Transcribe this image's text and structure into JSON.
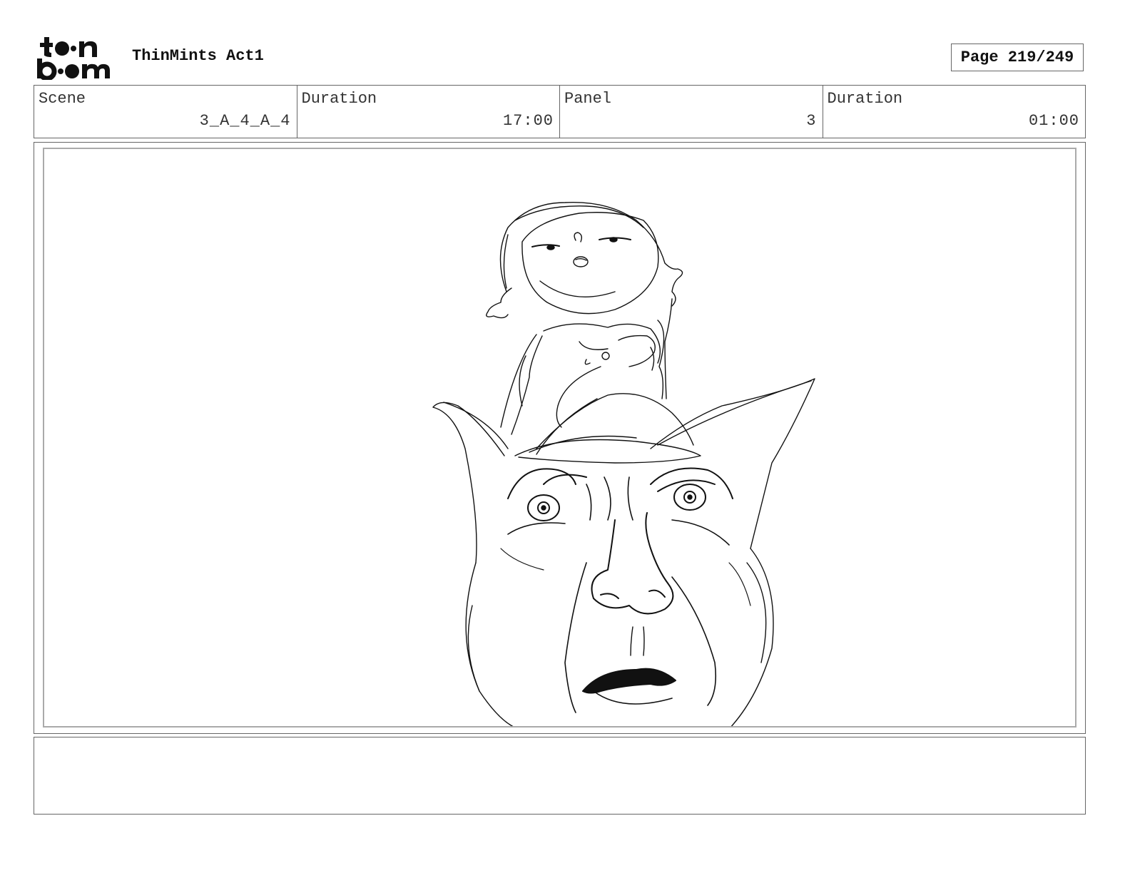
{
  "header": {
    "logo_lines": [
      "toon",
      "boom"
    ],
    "project_title": "ThinMints Act1",
    "page_label": "Page 219/249"
  },
  "info": {
    "scene_label": "Scene",
    "scene_value": "3_A_4_A_4",
    "scene_duration_label": "Duration",
    "scene_duration_value": "17:00",
    "panel_label": "Panel",
    "panel_value": "3",
    "panel_duration_label": "Duration",
    "panel_duration_value": "01:00"
  },
  "panel": {
    "image_content": "pencil sketch of a small child sitting on top of the head of a large, old, frowning man with pointed ears"
  },
  "notes": {
    "text": ""
  }
}
